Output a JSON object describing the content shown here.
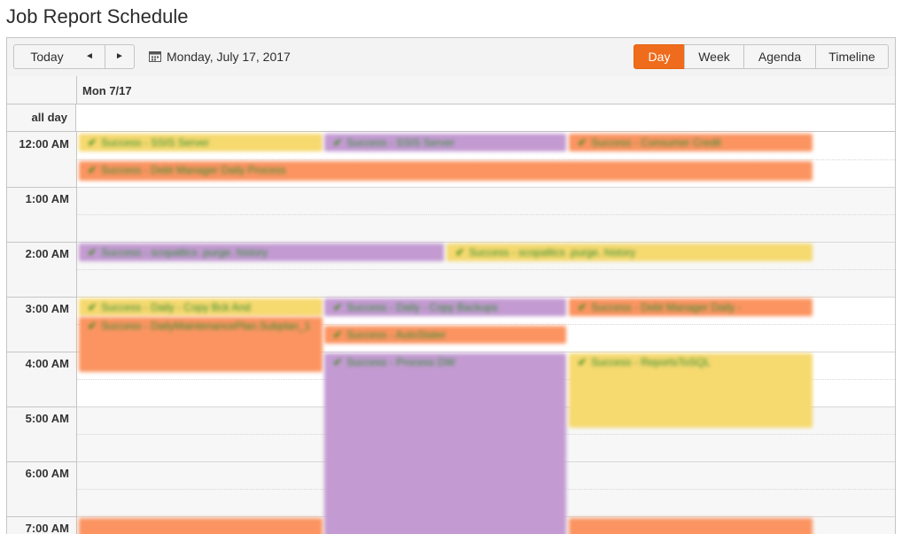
{
  "page": {
    "title": "Job Report Schedule"
  },
  "toolbar": {
    "today_label": "Today",
    "prev_icon": "◄",
    "next_icon": "►",
    "date_text": "Monday, July 17, 2017",
    "views": [
      "Day",
      "Week",
      "Agenda",
      "Timeline"
    ],
    "active_view": "Day"
  },
  "header": {
    "day_label": "Mon 7/17",
    "allday_label": "all day"
  },
  "times": [
    "12:00 AM",
    "1:00 AM",
    "2:00 AM",
    "3:00 AM",
    "4:00 AM",
    "5:00 AM",
    "6:00 AM",
    "7:00 AM"
  ],
  "colors": {
    "accent": "#ef6c1c",
    "yellow": "#f6d96f",
    "purple": "#c39ad2",
    "orange": "#fb9461"
  },
  "events": [
    {
      "text": "Success - SSIS Server",
      "color": "yellow"
    },
    {
      "text": "Success - SSIS Server",
      "color": "purple"
    },
    {
      "text": "Success - Consumer Credit",
      "color": "orange"
    },
    {
      "text": "Success - Debt Manager Daily Process",
      "color": "orange"
    },
    {
      "text": "Success - scopaltics .purge. history",
      "color": "purple"
    },
    {
      "text": "Success - scopaltics .purge. history",
      "color": "yellow"
    },
    {
      "text": "Success - Daily - Copy Bck And",
      "color": "yellow"
    },
    {
      "text": "Success - Daily - Copy Backups",
      "color": "purple"
    },
    {
      "text": "Success - Debt Manager Daily -",
      "color": "orange"
    },
    {
      "text": "Success - DailyMaintenancePlan.Subplan_1",
      "color": "orange"
    },
    {
      "text": "Success - AutoStater",
      "color": "orange"
    },
    {
      "text": "Success - Process DW",
      "color": "purple"
    },
    {
      "text": "Success - ReportsToSQL",
      "color": "yellow"
    }
  ]
}
